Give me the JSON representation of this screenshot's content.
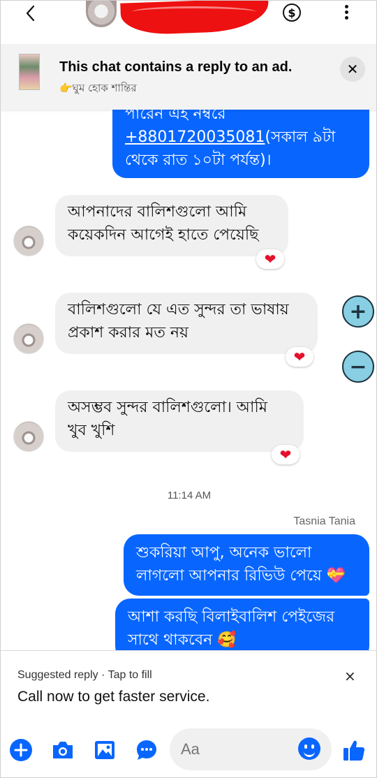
{
  "header": {
    "back_icon": "chevron-left-icon",
    "pay_icon": "dollar-circle-icon",
    "menu_icon": "more-vertical-icon"
  },
  "ad_banner": {
    "title": "This chat contains a reply to an ad.",
    "subtitle": "👉ঘুম হোক শান্তির",
    "close_icon": "close-icon"
  },
  "messages": [
    {
      "dir": "out",
      "lines": [
        "পারেন এই নম্বরে",
        "+8801720035081",
        "(সকাল ৯টা",
        "থেকে রাত ১০টা পর্যন্ত)।"
      ]
    },
    {
      "dir": "in",
      "lines": [
        "আপনাদের বালিশগুলো আমি",
        "কয়েকদিন আগেই হাতে পেয়েছি"
      ],
      "reaction": "❤"
    },
    {
      "dir": "in",
      "lines": [
        "বালিশগুলো যে এত সুন্দর তা ভাষায়",
        "প্রকাশ করার মত নয়"
      ],
      "reaction": "❤"
    },
    {
      "dir": "in",
      "lines": [
        "অসম্ভব সুন্দর বালিশগুলো।  আমি",
        "খুব খুশি"
      ],
      "reaction": "❤"
    },
    {
      "dir": "out",
      "lines": [
        "শুকরিয়া আপু, অনেক ভালো",
        "লাগলো আপনার রিভিউ পেয়ে 💝"
      ]
    },
    {
      "dir": "out",
      "lines": [
        "আশা করছি বিলাইবালিশ পেইজের",
        "সাথে থাকবেন 🥰"
      ]
    }
  ],
  "timestamp": "11:14 AM",
  "sender_name": "Tasnia Tania",
  "zoom": {
    "plus": "+",
    "minus": "−"
  },
  "suggestion": {
    "hint_label": "Suggested reply",
    "separator": "·",
    "hint_action": "Tap to fill",
    "text": "Call now to get faster service.",
    "close": "×"
  },
  "composer": {
    "placeholder": "Aa",
    "icons": [
      "plus-icon",
      "camera-icon",
      "image-icon",
      "chat-bubble-icon",
      "emoji-icon",
      "thumbs-up-icon"
    ]
  },
  "colors": {
    "accent": "#0866ff",
    "incoming": "#f0f0f0",
    "heart": "#e5102d",
    "zoom_button": "#88cfe3"
  }
}
